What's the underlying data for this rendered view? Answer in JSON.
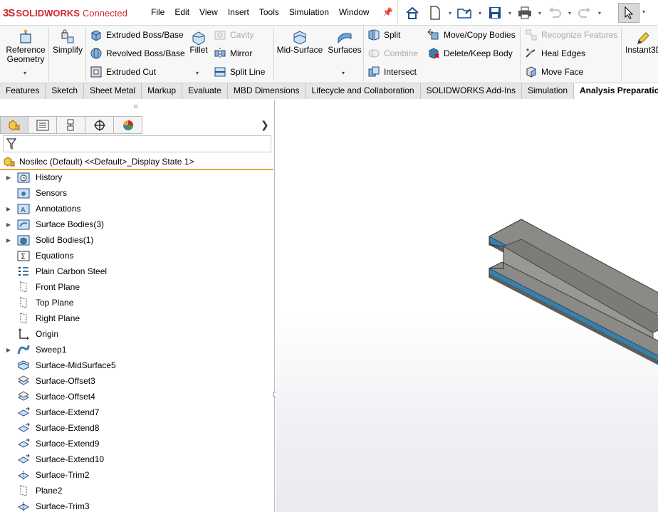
{
  "app": {
    "logo_mark": "3S",
    "brand": "SOLIDWORKS",
    "brand_suffix": "Connected"
  },
  "menu": [
    "File",
    "Edit",
    "View",
    "Insert",
    "Tools",
    "Simulation",
    "Window"
  ],
  "ribbon": {
    "reference_geometry": "Reference Geometry",
    "simplify": "Simplify",
    "extruded_boss": "Extruded Boss/Base",
    "revolved_boss": "Revolved Boss/Base",
    "extruded_cut": "Extruded Cut",
    "fillet": "Fillet",
    "cavity": "Cavity",
    "mirror": "Mirror",
    "split_line": "Split Line",
    "mid_surface": "Mid-Surface",
    "surfaces": "Surfaces",
    "split": "Split",
    "combine": "Combine",
    "intersect": "Intersect",
    "move_copy_bodies": "Move/Copy Bodies",
    "delete_keep_body": "Delete/Keep Body",
    "recognize_features": "Recognize Features",
    "heal_edges": "Heal Edges",
    "move_face": "Move Face",
    "instant3d": "Instant3D"
  },
  "tabs": [
    {
      "label": "Features",
      "active": false
    },
    {
      "label": "Sketch",
      "active": false
    },
    {
      "label": "Sheet Metal",
      "active": false
    },
    {
      "label": "Markup",
      "active": false
    },
    {
      "label": "Evaluate",
      "active": false
    },
    {
      "label": "MBD Dimensions",
      "active": false
    },
    {
      "label": "Lifecycle and Collaboration",
      "active": false
    },
    {
      "label": "SOLIDWORKS Add-Ins",
      "active": false
    },
    {
      "label": "Simulation",
      "active": false
    },
    {
      "label": "Analysis Preparation",
      "active": true
    }
  ],
  "tree": {
    "root": "Nosilec (Default) <<Default>_Display State 1>",
    "items": [
      {
        "label": "History",
        "icon": "history-folder-icon",
        "expandable": true
      },
      {
        "label": "Sensors",
        "icon": "sensors-folder-icon",
        "expandable": false
      },
      {
        "label": "Annotations",
        "icon": "annotations-folder-icon",
        "expandable": true
      },
      {
        "label": "Surface Bodies(3)",
        "icon": "surface-bodies-folder-icon",
        "expandable": true
      },
      {
        "label": "Solid Bodies(1)",
        "icon": "solid-bodies-folder-icon",
        "expandable": true
      },
      {
        "label": "Equations",
        "icon": "equations-folder-icon",
        "expandable": false
      },
      {
        "label": "Plain Carbon Steel",
        "icon": "material-icon",
        "expandable": false
      },
      {
        "label": "Front Plane",
        "icon": "plane-icon",
        "expandable": false
      },
      {
        "label": "Top Plane",
        "icon": "plane-icon",
        "expandable": false
      },
      {
        "label": "Right Plane",
        "icon": "plane-icon",
        "expandable": false
      },
      {
        "label": "Origin",
        "icon": "origin-icon",
        "expandable": false
      },
      {
        "label": "Sweep1",
        "icon": "sweep-icon",
        "expandable": true
      },
      {
        "label": "Surface-MidSurface5",
        "icon": "midsurface-icon",
        "expandable": false
      },
      {
        "label": "Surface-Offset3",
        "icon": "offset-surface-icon",
        "expandable": false
      },
      {
        "label": "Surface-Offset4",
        "icon": "offset-surface-icon",
        "expandable": false
      },
      {
        "label": "Surface-Extend7",
        "icon": "extend-surface-icon",
        "expandable": false
      },
      {
        "label": "Surface-Extend8",
        "icon": "extend-surface-icon",
        "expandable": false
      },
      {
        "label": "Surface-Extend9",
        "icon": "extend-surface-icon",
        "expandable": false
      },
      {
        "label": "Surface-Extend10",
        "icon": "extend-surface-icon",
        "expandable": false
      },
      {
        "label": "Surface-Trim2",
        "icon": "trim-surface-icon",
        "expandable": false
      },
      {
        "label": "Plane2",
        "icon": "plane-icon",
        "expandable": false
      },
      {
        "label": "Surface-Trim3",
        "icon": "trim-surface-icon",
        "expandable": false
      }
    ]
  },
  "colors": {
    "brand_red": "#d0282e",
    "tree_accent": "#e8a23a",
    "beam_top": "#8c8a86",
    "beam_edge": "#3a7fa8"
  }
}
